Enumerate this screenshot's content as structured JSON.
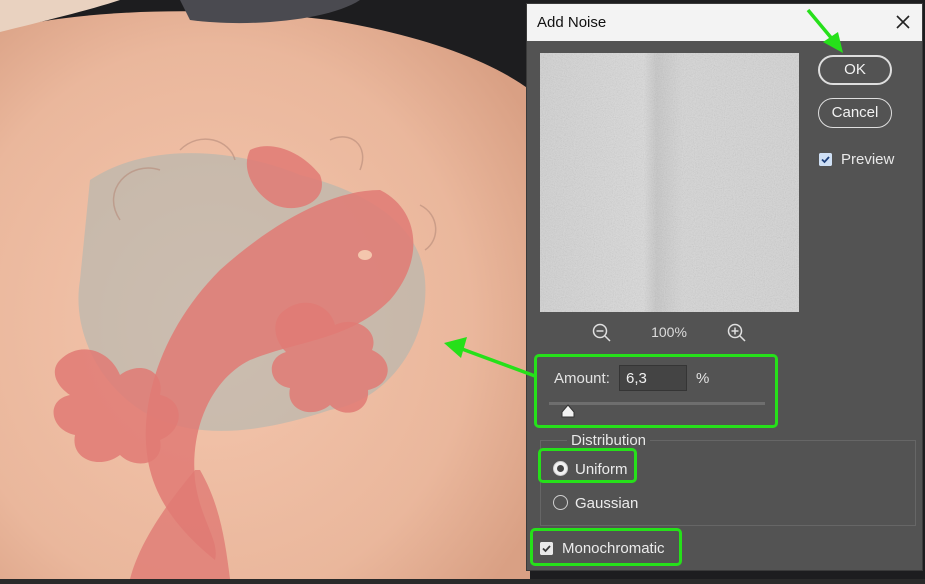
{
  "dialog": {
    "title": "Add Noise",
    "close_icon": "close-icon",
    "ok_label": "OK",
    "cancel_label": "Cancel",
    "preview_label": "Preview",
    "preview_checked": true,
    "zoom_level": "100%",
    "amount_label": "Amount:",
    "amount_value": "6,3",
    "amount_unit": "%",
    "distribution_label": "Distribution",
    "uniform_label": "Uniform",
    "uniform_selected": true,
    "gaussian_label": "Gaussian",
    "gaussian_selected": false,
    "monochromatic_label": "Monochromatic",
    "monochromatic_checked": true
  },
  "colors": {
    "dialog_bg": "#535353",
    "titlebar_bg": "#f3f3f3",
    "highlight": "#26e01a",
    "tattoo_red": "#e07a74",
    "tattoo_blue": "#a9b6b3"
  }
}
